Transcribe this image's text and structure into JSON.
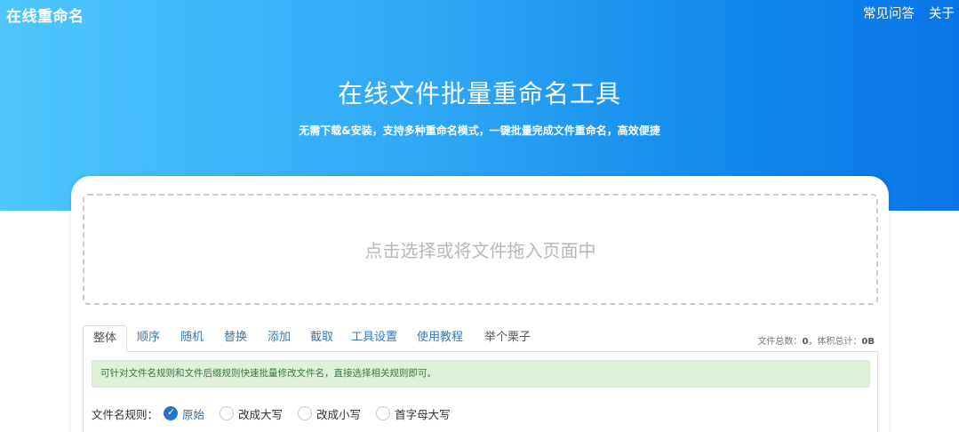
{
  "header": {
    "brand": "在线重命名",
    "nav": [
      "常见问答",
      "关于"
    ]
  },
  "hero": {
    "title": "在线文件批量重命名工具",
    "subtitle": "无需下载&安装，支持多种重命名模式，一键批量完成文件重命名，高效便捷"
  },
  "dropzone": {
    "prompt": "点击选择或将文件拖入页面中"
  },
  "tabs": [
    {
      "label": "整体",
      "active": true
    },
    {
      "label": "顺序"
    },
    {
      "label": "随机"
    },
    {
      "label": "替换"
    },
    {
      "label": "添加"
    },
    {
      "label": "截取"
    },
    {
      "label": "工具设置"
    },
    {
      "label": "使用教程"
    },
    {
      "label": "举个栗子"
    }
  ],
  "stats": {
    "count_label": "文件总数：",
    "count_value": "0",
    "size_label": "，体积总计：",
    "size_value": "0B"
  },
  "notice": "可针对文件名规则和文件后缀规则快速批量修改文件名，直接选择相关规则即可。",
  "rule": {
    "label": "文件名规则：",
    "options": [
      {
        "label": "原始",
        "checked": true
      },
      {
        "label": "改成大写",
        "checked": false
      },
      {
        "label": "改成小写",
        "checked": false
      },
      {
        "label": "首字母大写",
        "checked": false
      }
    ]
  },
  "colors": {
    "hero_start": "#4ec7fd",
    "hero_end": "#0a74e6",
    "link": "#337ab7",
    "notice_bg": "#dff0d8",
    "radio_checked": "#2574c9"
  }
}
